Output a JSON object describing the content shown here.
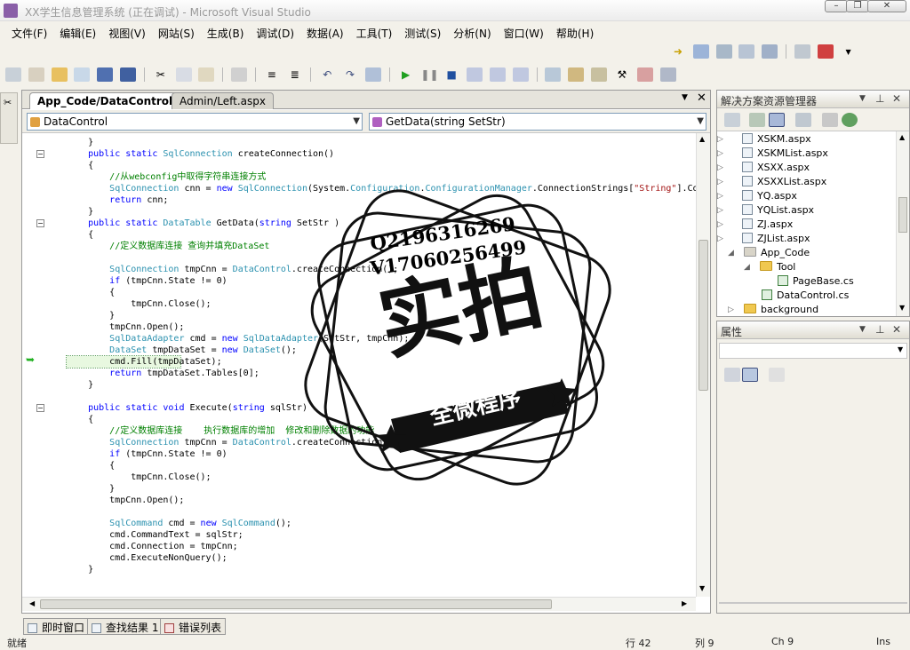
{
  "window": {
    "title": "XX学生信息管理系统 (正在调试) - Microsoft Visual Studio"
  },
  "menu": [
    "文件(F)",
    "编辑(E)",
    "视图(V)",
    "网站(S)",
    "生成(B)",
    "调试(D)",
    "数据(A)",
    "工具(T)",
    "测试(S)",
    "分析(N)",
    "窗口(W)",
    "帮助(H)"
  ],
  "editor": {
    "tabs": [
      {
        "label": "App_Code/DataControl.cs",
        "active": true
      },
      {
        "label": "Admin/Left.aspx",
        "active": false
      }
    ],
    "class_combo": "DataControl",
    "member_combo": "GetData(string SetStr)",
    "lines": [
      "    }",
      "    public static SqlConnection createConnection()",
      "    {",
      "        //从webconfig中取得字符串连接方式",
      "        SqlConnection cnn = new SqlConnection(System.Configuration.ConfigurationManager.ConnectionStrings[\"String\"].Conne",
      "        return cnn;",
      "    }",
      "    public static DataTable GetData(string SetStr )",
      "    {",
      "        //定义数据库连接 查询并填充DataSet",
      "",
      "        SqlConnection tmpCnn = DataControl.createConnection();",
      "        if (tmpCnn.State != 0)",
      "        {",
      "            tmpCnn.Close();",
      "        }",
      "        tmpCnn.Open();",
      "        SqlDataAdapter cmd = new SqlDataAdapter(SetStr, tmpCnn);",
      "        DataSet tmpDataSet = new DataSet();",
      "        cmd.Fill(tmpDataSet);",
      "        return tmpDataSet.Tables[0];",
      "    }",
      "",
      "    public static void Execute(string sqlStr)",
      "    {",
      "        //定义数据库连接    执行数据库的增加  修改和删除数据的功能",
      "        SqlConnection tmpCnn = DataControl.createConnection();",
      "        if (tmpCnn.State != 0)",
      "        {",
      "            tmpCnn.Close();",
      "        }",
      "        tmpCnn.Open();",
      "",
      "        SqlCommand cmd = new SqlCommand();",
      "        cmd.CommandText = sqlStr;",
      "        cmd.Connection = tmpCnn;",
      "        cmd.ExecuteNonQuery();",
      "    }"
    ]
  },
  "solution_explorer": {
    "title": "解决方案资源管理器",
    "items": [
      "XSKM.aspx",
      "XSKMList.aspx",
      "XSXX.aspx",
      "XSXXList.aspx",
      "YQ.aspx",
      "YQList.aspx",
      "ZJ.aspx",
      "ZJList.aspx",
      "App_Code",
      "Tool",
      "PageBase.cs",
      "DataControl.cs",
      "background"
    ]
  },
  "properties": {
    "title": "属性"
  },
  "bottom_tabs": [
    "即时窗口",
    "查找结果 1",
    "错误列表"
  ],
  "status": {
    "ready": "就绪",
    "line": "行 42",
    "col": "列 9",
    "ch": "Ch 9",
    "ins": "Ins"
  },
  "watermark": {
    "contact1": "Q2196316269",
    "contact2": "V17060256499",
    "main": "实拍",
    "sub": "全微程序"
  },
  "colors": {
    "keyword": "#0000ff",
    "type": "#2b91af",
    "comment": "#008000",
    "string": "#a31515"
  }
}
